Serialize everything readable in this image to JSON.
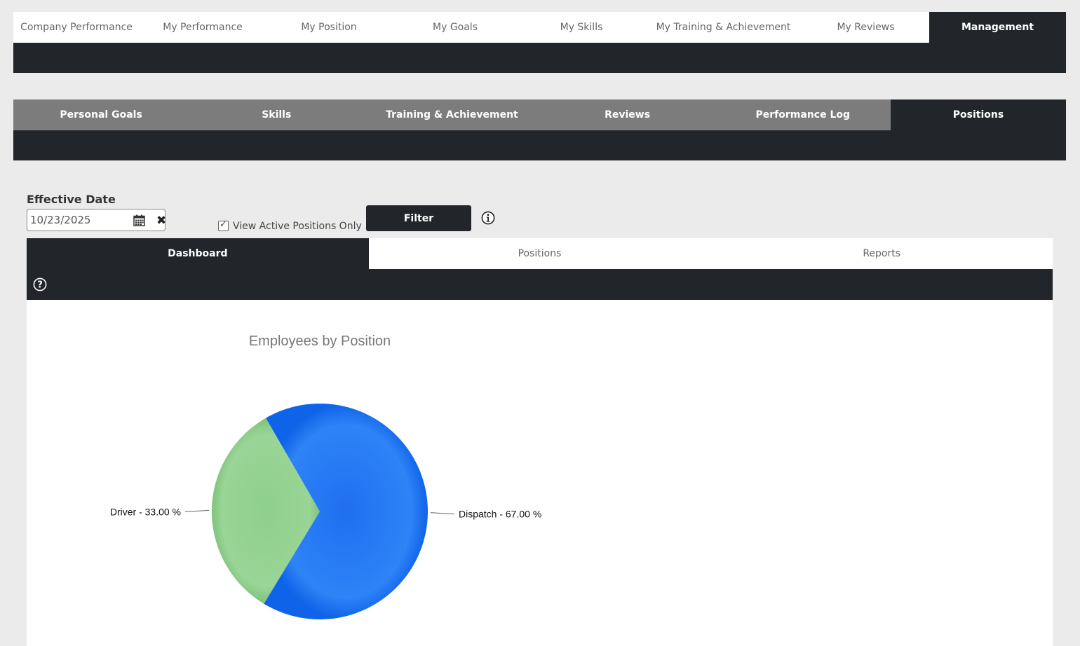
{
  "topnav": {
    "tabs": [
      {
        "label": "Company Performance"
      },
      {
        "label": "My Performance"
      },
      {
        "label": "My Position"
      },
      {
        "label": "My Goals"
      },
      {
        "label": "My Skills"
      },
      {
        "label": "My Training & Achievement"
      },
      {
        "label": "My Reviews"
      },
      {
        "label": "Management"
      }
    ],
    "active_index": 7
  },
  "subnav": {
    "tabs": [
      {
        "label": "Personal Goals"
      },
      {
        "label": "Skills"
      },
      {
        "label": "Training & Achievement"
      },
      {
        "label": "Reviews"
      },
      {
        "label": "Performance Log"
      },
      {
        "label": "Positions"
      }
    ],
    "active_index": 5
  },
  "filter": {
    "effective_date_label": "Effective Date",
    "effective_date_value": "10/23/2025",
    "active_only_label": "View Active Positions Only",
    "active_only_checked": true,
    "filter_button_label": "Filter",
    "calendar_icon": "calendar-icon",
    "clear_icon": "clear-icon",
    "info_icon": "info-icon"
  },
  "inner_tabs": {
    "tabs": [
      {
        "label": "Dashboard"
      },
      {
        "label": "Positions"
      },
      {
        "label": "Reports"
      }
    ],
    "active_index": 0,
    "help_icon": "help-icon"
  },
  "colors": {
    "dark": "#22252a",
    "subnav_gray": "#7c7c7c",
    "dispatch": "#2b7ff5",
    "driver": "#92d18f"
  },
  "chart_data": {
    "type": "pie",
    "title": "Employees by Position",
    "slices": [
      {
        "label": "Dispatch - 67.00 %",
        "category": "Dispatch",
        "value": 67.0,
        "color": "#2b7ff5"
      },
      {
        "label": "Driver - 33.00 %",
        "category": "Driver",
        "value": 33.0,
        "color": "#92d18f"
      }
    ]
  }
}
